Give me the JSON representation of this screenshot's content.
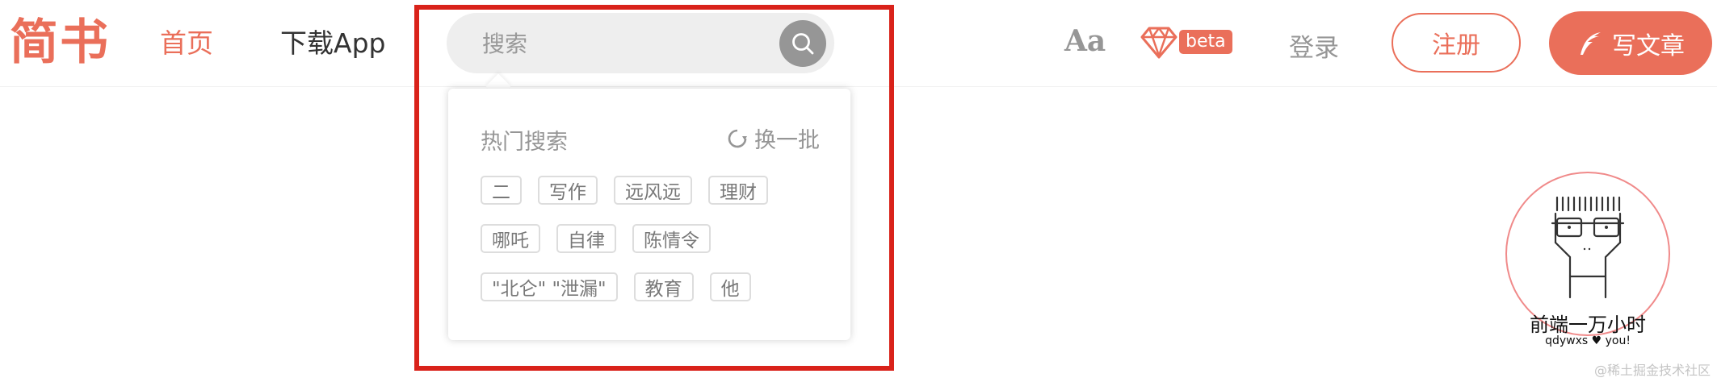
{
  "header": {
    "logo": "简书",
    "nav": {
      "home": "首页",
      "download_app": "下载App"
    },
    "search": {
      "placeholder": "搜索"
    },
    "font_setting_label": "Aa",
    "beta_label": "beta",
    "login_label": "登录",
    "register_label": "注册",
    "write_label": "写文章"
  },
  "hot_search": {
    "title": "热门搜索",
    "refresh_label": "换一批",
    "tag_rows": [
      [
        "二",
        "写作",
        "远风远",
        "理财"
      ],
      [
        "哪吒",
        "自律",
        "陈情令"
      ],
      [
        "\"北仑\" \"泄漏\"",
        "教育",
        "他"
      ]
    ]
  },
  "avatar_badge": {
    "name": "前端一万小时",
    "subtitle": "qdywxs ♥ you!"
  },
  "watermark": "@稀土掘金技术社区",
  "colors": {
    "brand": "#ea6f5a",
    "highlight": "#d9221a",
    "muted_text": "#969696",
    "search_bg": "#eeeeee"
  }
}
